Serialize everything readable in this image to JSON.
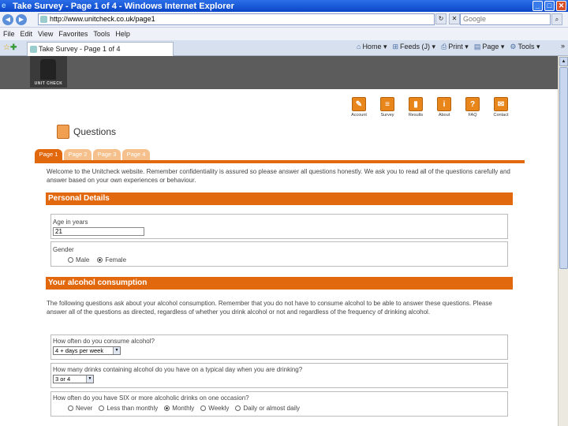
{
  "window": {
    "title": "Take Survey - Page 1 of 4 - Windows Internet Explorer",
    "min": "_",
    "max": "□",
    "close": "✕"
  },
  "addressbar": {
    "back": "◀",
    "forward": "▶",
    "url": "http://www.unitcheck.co.uk/page1",
    "refresh": "↻",
    "stop": "✕",
    "search_placeholder": "Google",
    "search_button": "⌕"
  },
  "menu": [
    "File",
    "Edit",
    "View",
    "Favorites",
    "Tools",
    "Help"
  ],
  "tab": {
    "stars": "☆",
    "add": "✚",
    "label": "Take Survey - Page 1 of 4",
    "tools": [
      {
        "icon": "⌂",
        "label": "Home"
      },
      {
        "icon": "⊞",
        "label": "Feeds (J)"
      },
      {
        "icon": "⎙",
        "label": "Print"
      },
      {
        "icon": "▤",
        "label": "Page"
      },
      {
        "icon": "⚙",
        "label": "Tools"
      }
    ],
    "chevron": "»"
  },
  "logo_text": "UNIT CHECK",
  "topnav": [
    {
      "icon": "✎",
      "label": "Account"
    },
    {
      "icon": "≡",
      "label": "Survey"
    },
    {
      "icon": "▮",
      "label": "Results"
    },
    {
      "icon": "i",
      "label": "About"
    },
    {
      "icon": "?",
      "label": "FAQ"
    },
    {
      "icon": "✉",
      "label": "Contact"
    }
  ],
  "page_heading": "Questions",
  "page_tabs": [
    "Page 1",
    "Page 2",
    "Page 3",
    "Page 4"
  ],
  "intro": "Welcome to the Unitcheck website. Remember confidentiality is assured so please answer all questions honestly. We ask you to read all of the questions carefully and answer based on your own experiences or behaviour.",
  "personal": {
    "header": "Personal Details",
    "age_label": "Age in years",
    "age_value": "21",
    "gender_label": "Gender",
    "gender_options": [
      "Male",
      "Female"
    ],
    "gender_selected": "Female"
  },
  "alcohol": {
    "header": "Your alcohol consumption",
    "intro": "The following questions ask about your alcohol consumption. Remember that you do not have to consume alcohol to be able to answer these questions. Please answer all of the questions as directed, regardless of whether you drink alcohol or not and regardless of the frequency of drinking alcohol.",
    "q1_label": "How often do you consume alcohol?",
    "q1_value": "4 + days per week",
    "q2_label": "How many drinks containing alcohol do you have on a typical day when you are drinking?",
    "q2_value": "3 or 4",
    "q3_label": "How often do you have SIX or more alcoholic drinks on one occasion?",
    "q3_options": [
      "Never",
      "Less than monthly",
      "Monthly",
      "Weekly",
      "Daily or almost daily"
    ],
    "q3_selected": "Monthly"
  }
}
